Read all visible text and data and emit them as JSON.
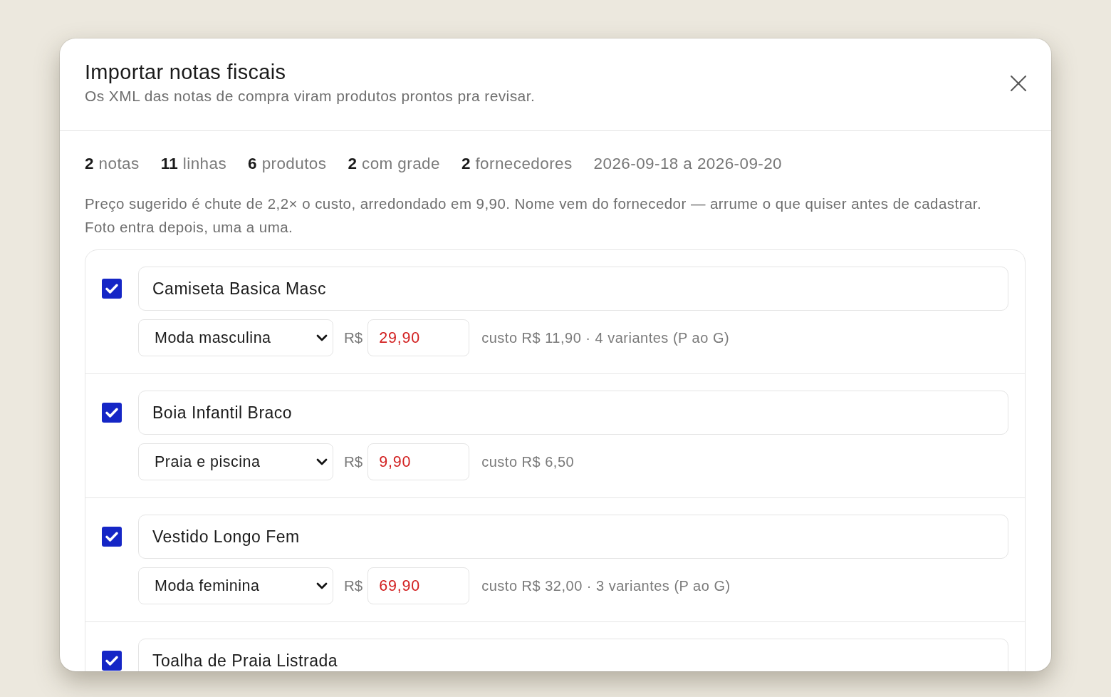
{
  "dialog": {
    "title": "Importar notas fiscais",
    "subtitle": "Os XML das notas de compra viram produtos prontos pra revisar."
  },
  "summary": {
    "stats": [
      "**2** notas",
      "**11** linhas",
      "**6** produtos",
      "**2** com grade",
      "**2** fornecedores"
    ],
    "date_range": "2026-09-18 a 2026-09-20"
  },
  "note": "Preço sugerido é chute de 2,2× o custo, arredondado em 9,90. Nome vem do fornecedor — arrume o que quiser antes de cadastrar. Foto entra depois, uma a uma.",
  "products": [
    {
      "checked": true,
      "name": "Camiseta Basica Masc",
      "category": "Moda masculina",
      "currency": "R$",
      "price": "29,90",
      "cost_info": "custo R$ 11,90 · 4 variantes (P ao G)"
    },
    {
      "checked": true,
      "name": "Boia Infantil Braco",
      "category": "Praia e piscina",
      "currency": "R$",
      "price": "9,90",
      "cost_info": "custo R$ 6,50"
    },
    {
      "checked": true,
      "name": "Vestido Longo Fem",
      "category": "Moda feminina",
      "currency": "R$",
      "price": "69,90",
      "cost_info": "custo R$ 32,00 · 3 variantes (P ao G)"
    },
    {
      "checked": true,
      "name": "Toalha de Praia Listrada"
    }
  ]
}
